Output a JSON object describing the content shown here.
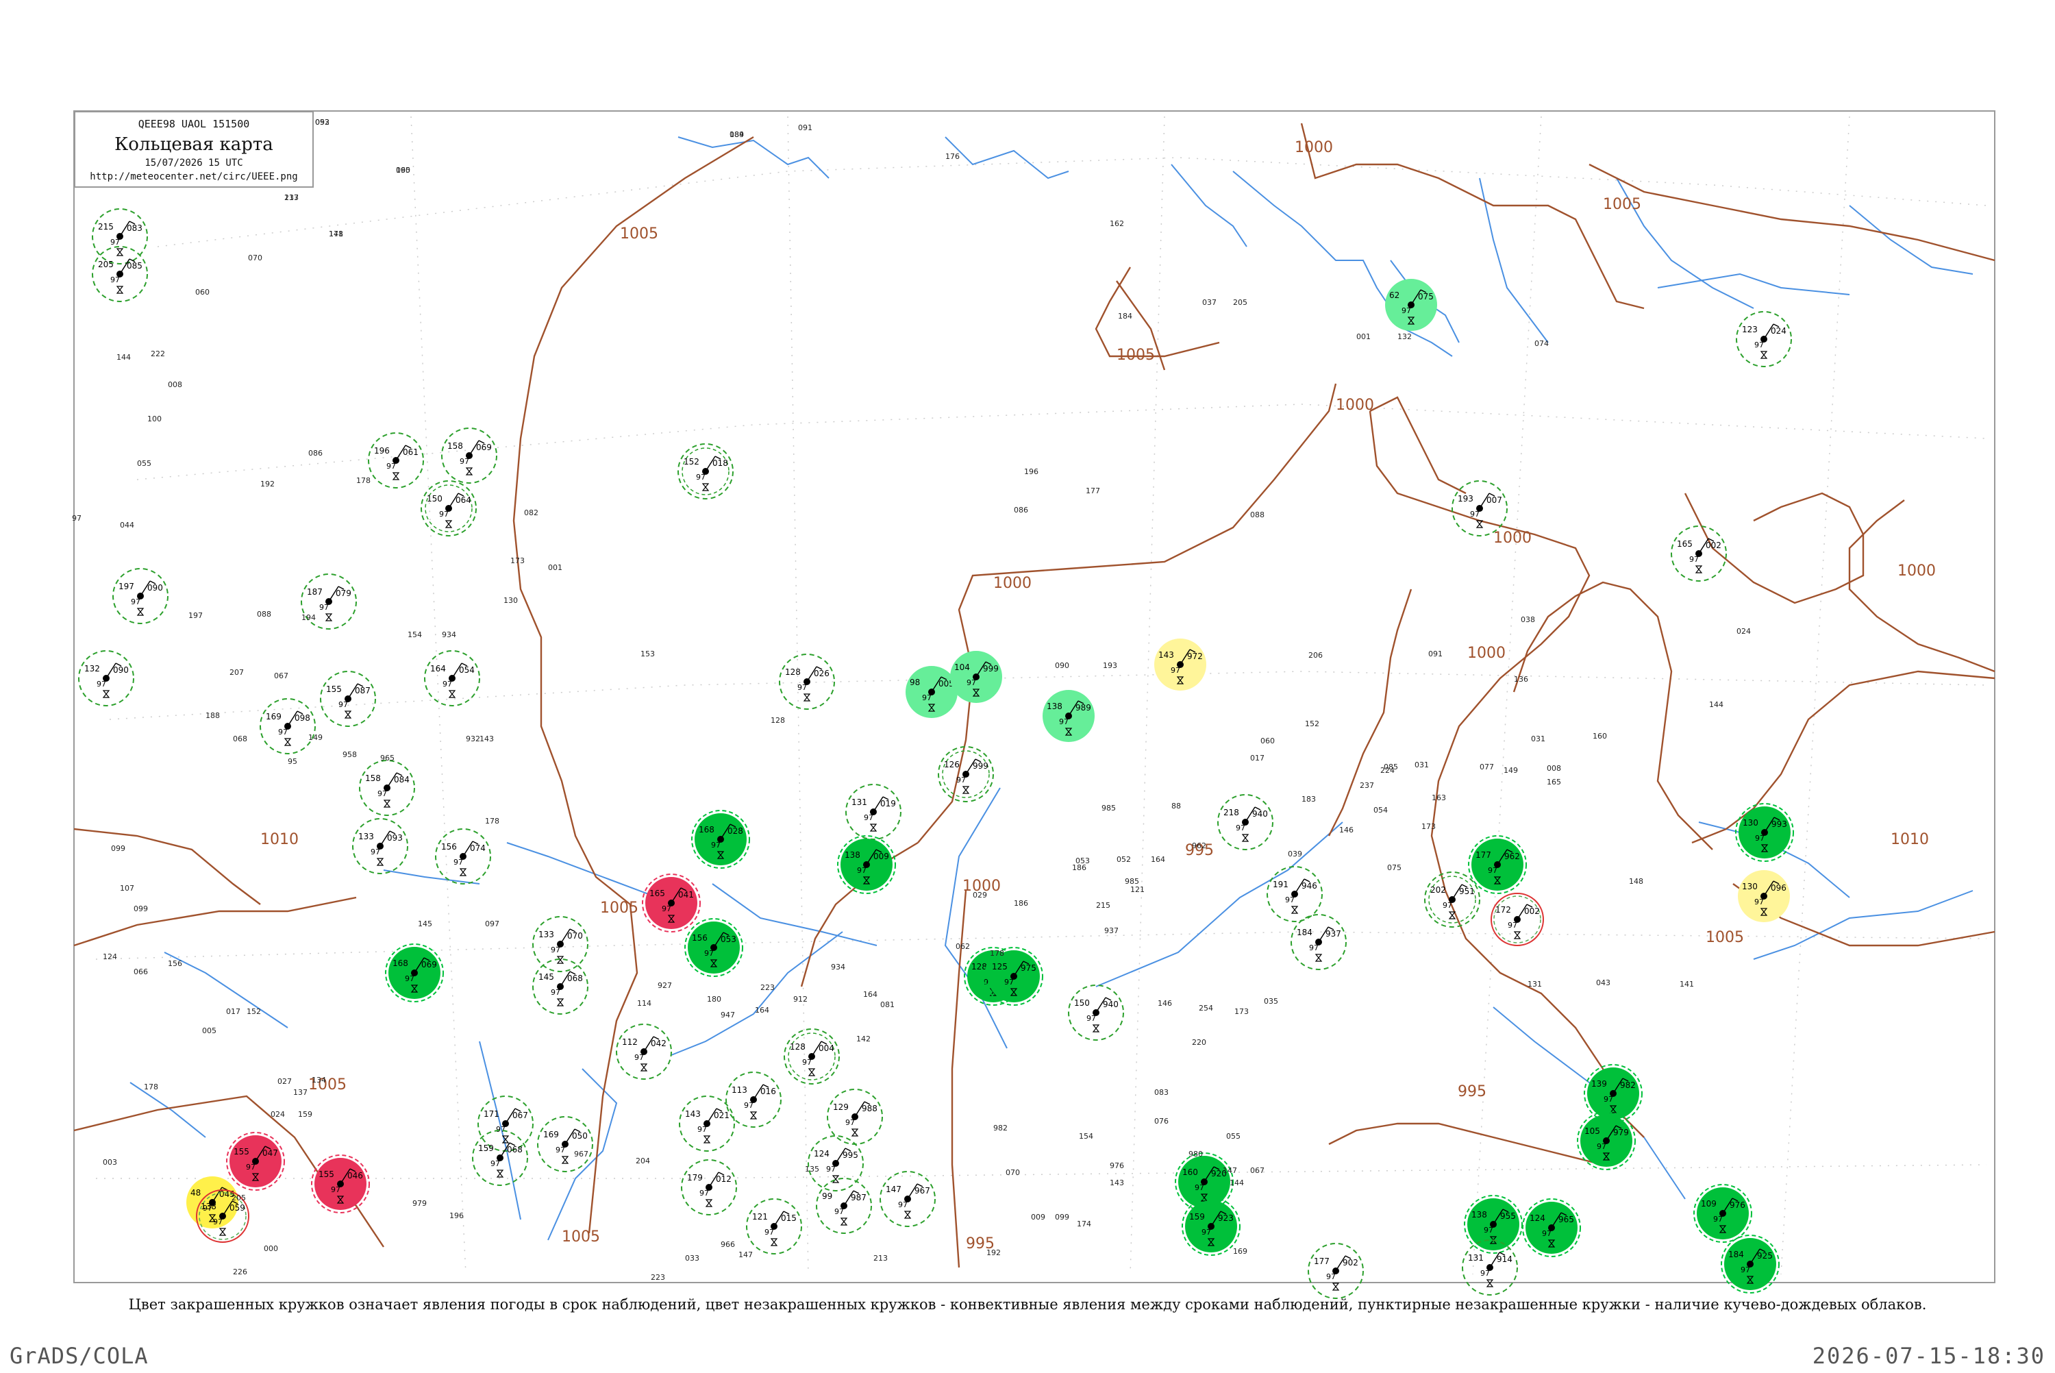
{
  "header": {
    "codes": "QEEE98  UAOL  151500",
    "title": "Кольцевая карта",
    "time": "15/07/2026 15 UTC",
    "url": "http://meteocenter.net/circ/UEEE.png"
  },
  "legend_text": "Цвет закрашенных кружков означает явления погоды в срок наблюдений, цвет незакрашенных кружков - конвективные явления между сроками наблюдений, пунктирные незакрашенные кружки - наличие кучево-дождевых облаков.",
  "footer": {
    "left": "GrADS/COLA",
    "right": "2026-07-15-18:30"
  },
  "colors": {
    "isobar": "#a0522d",
    "water": "#4a90e2",
    "dashed_circle": "#2ca02c",
    "green_fill": "#00c03a",
    "light_green_fill": "#66ee99",
    "red_fill": "#e8335a",
    "yellow_fill": "#fff04a",
    "pale_yellow_fill": "#fff59a"
  },
  "isobar_labels": [
    "1010",
    "1005",
    "1005",
    "1005",
    "1005",
    "1000",
    "1000",
    "1000",
    "1000",
    "1000",
    "995",
    "995",
    "995",
    "1005",
    "1010",
    "1005",
    "1005",
    "1000",
    "1000"
  ],
  "stations": [
    {
      "id": "s1",
      "t": "215",
      "p": "083",
      "style": "dashed",
      "fill": "none"
    },
    {
      "id": "s2",
      "t": "205",
      "p": "085",
      "style": "dashed",
      "fill": "none"
    },
    {
      "id": "s3",
      "t": "152",
      "p": "018",
      "style": "dashed2",
      "fill": "none"
    },
    {
      "id": "s4",
      "t": "150",
      "p": "064",
      "style": "dashed2",
      "fill": "none"
    },
    {
      "id": "s5",
      "t": "196",
      "p": "061",
      "style": "dashed",
      "fill": "none"
    },
    {
      "id": "s6",
      "t": "158",
      "p": "069",
      "style": "dashed",
      "fill": "none"
    },
    {
      "id": "s7",
      "t": "197",
      "p": "090",
      "style": "dashed",
      "fill": "none"
    },
    {
      "id": "s8",
      "t": "187",
      "p": "079",
      "style": "dashed",
      "fill": "none"
    },
    {
      "id": "s9",
      "t": "132",
      "p": "090",
      "style": "dashed",
      "fill": "none"
    },
    {
      "id": "s10",
      "t": "155",
      "p": "087",
      "style": "dashed",
      "fill": "none"
    },
    {
      "id": "s11",
      "t": "164",
      "p": "054",
      "style": "dashed",
      "fill": "none"
    },
    {
      "id": "s12",
      "t": "128",
      "p": "026",
      "style": "dashed",
      "fill": "none"
    },
    {
      "id": "s13",
      "t": "98",
      "p": "005",
      "style": "fill",
      "fill": "light_green"
    },
    {
      "id": "s14",
      "t": "104",
      "p": "999",
      "style": "fill",
      "fill": "light_green"
    },
    {
      "id": "s15",
      "t": "138",
      "p": "989",
      "style": "fill",
      "fill": "light_green"
    },
    {
      "id": "s16",
      "t": "143",
      "p": "972",
      "style": "fill",
      "fill": "pale_yellow"
    },
    {
      "id": "s17",
      "t": "62",
      "p": "075",
      "style": "fill",
      "fill": "light_green"
    },
    {
      "id": "s18",
      "t": "123",
      "p": "024",
      "style": "dashed",
      "fill": "none"
    },
    {
      "id": "s19",
      "t": "193",
      "p": "007",
      "style": "dashed",
      "fill": "none"
    },
    {
      "id": "s20",
      "t": "165",
      "p": "002",
      "style": "dashed",
      "fill": "none"
    },
    {
      "id": "s21",
      "t": "158",
      "p": "084",
      "style": "dashed",
      "fill": "none"
    },
    {
      "id": "s22",
      "t": "133",
      "p": "093",
      "style": "dashed",
      "fill": "none"
    },
    {
      "id": "s23",
      "t": "169",
      "p": "098",
      "style": "dashed",
      "fill": "none"
    },
    {
      "id": "s24",
      "t": "156",
      "p": "074",
      "style": "dashed",
      "fill": "none"
    },
    {
      "id": "s25",
      "t": "133",
      "p": "070",
      "style": "dashed",
      "fill": "none"
    },
    {
      "id": "s26",
      "t": "145",
      "p": "068",
      "style": "dashed",
      "fill": "none"
    },
    {
      "id": "s27",
      "t": "168",
      "p": "069",
      "style": "fill",
      "fill": "green"
    },
    {
      "id": "s28",
      "t": "165",
      "p": "041",
      "style": "fill",
      "fill": "red"
    },
    {
      "id": "s29",
      "t": "156",
      "p": "053",
      "style": "fill",
      "fill": "green"
    },
    {
      "id": "s30",
      "t": "168",
      "p": "028",
      "style": "fill",
      "fill": "green"
    },
    {
      "id": "s31",
      "t": "131",
      "p": "019",
      "style": "dashed",
      "fill": "none"
    },
    {
      "id": "s32",
      "t": "138",
      "p": "009",
      "style": "fill",
      "fill": "green"
    },
    {
      "id": "s33",
      "t": "126",
      "p": "999",
      "style": "dashed2",
      "fill": "none"
    },
    {
      "id": "s34",
      "t": "128",
      "p": "985",
      "style": "fill",
      "fill": "green"
    },
    {
      "id": "s35",
      "t": "218",
      "p": "940",
      "style": "dashed",
      "fill": "none"
    },
    {
      "id": "s36",
      "t": "191",
      "p": "946",
      "style": "dashed",
      "fill": "none"
    },
    {
      "id": "s37",
      "t": "184",
      "p": "937",
      "style": "dashed",
      "fill": "none"
    },
    {
      "id": "s38",
      "t": "202",
      "p": "951",
      "style": "dashed2",
      "fill": "none"
    },
    {
      "id": "s39",
      "t": "177",
      "p": "962",
      "style": "fill",
      "fill": "green"
    },
    {
      "id": "s40",
      "t": "172",
      "p": "002",
      "style": "solid_red",
      "fill": "none"
    },
    {
      "id": "s41",
      "t": "130",
      "p": "096",
      "style": "fill",
      "fill": "pale_yellow"
    },
    {
      "id": "s42",
      "t": "130",
      "p": "993",
      "style": "fill",
      "fill": "green"
    },
    {
      "id": "s43",
      "t": "150",
      "p": "940",
      "style": "dashed",
      "fill": "none"
    },
    {
      "id": "s44",
      "t": "112",
      "p": "042",
      "style": "dashed",
      "fill": "none"
    },
    {
      "id": "s45",
      "t": "128",
      "p": "004",
      "style": "dashed2",
      "fill": "none"
    },
    {
      "id": "s46",
      "t": "143",
      "p": "021",
      "style": "dashed",
      "fill": "none"
    },
    {
      "id": "s47",
      "t": "113",
      "p": "016",
      "style": "dashed",
      "fill": "none"
    },
    {
      "id": "s48",
      "t": "179",
      "p": "012",
      "style": "dashed",
      "fill": "none"
    },
    {
      "id": "s49",
      "t": "121",
      "p": "015",
      "style": "dashed",
      "fill": "none"
    },
    {
      "id": "s50",
      "t": "124",
      "p": "995",
      "style": "dashed",
      "fill": "none"
    },
    {
      "id": "s51",
      "t": "129",
      "p": "988",
      "style": "dashed",
      "fill": "none"
    },
    {
      "id": "s52",
      "t": "99",
      "p": "987",
      "style": "dashed",
      "fill": "none"
    },
    {
      "id": "s53",
      "t": "147",
      "p": "967",
      "style": "dashed",
      "fill": "none"
    },
    {
      "id": "s54",
      "t": "171",
      "p": "067",
      "style": "dashed",
      "fill": "none"
    },
    {
      "id": "s55",
      "t": "159",
      "p": "068",
      "style": "dashed",
      "fill": "none"
    },
    {
      "id": "s56",
      "t": "169",
      "p": "050",
      "style": "dashed",
      "fill": "none"
    },
    {
      "id": "s57",
      "t": "155",
      "p": "047",
      "style": "fill",
      "fill": "red"
    },
    {
      "id": "s58",
      "t": "155",
      "p": "046",
      "style": "fill",
      "fill": "red"
    },
    {
      "id": "s59",
      "t": "48",
      "p": "045",
      "style": "fill",
      "fill": "yellow"
    },
    {
      "id": "s60",
      "t": "138",
      "p": "059",
      "style": "solid_red",
      "fill": "none"
    },
    {
      "id": "s61",
      "t": "125",
      "p": "975",
      "style": "fill",
      "fill": "green"
    },
    {
      "id": "s62",
      "t": "160",
      "p": "920",
      "style": "fill",
      "fill": "green"
    },
    {
      "id": "s63",
      "t": "159",
      "p": "923",
      "style": "fill",
      "fill": "green"
    },
    {
      "id": "s64",
      "t": "138",
      "p": "955",
      "style": "fill",
      "fill": "green"
    },
    {
      "id": "s65",
      "t": "124",
      "p": "965",
      "style": "fill",
      "fill": "green"
    },
    {
      "id": "s66",
      "t": "139",
      "p": "982",
      "style": "fill",
      "fill": "green"
    },
    {
      "id": "s67",
      "t": "105",
      "p": "979",
      "style": "fill",
      "fill": "green"
    },
    {
      "id": "s68",
      "t": "109",
      "p": "976",
      "style": "fill",
      "fill": "green"
    },
    {
      "id": "s69",
      "t": "177",
      "p": "902",
      "style": "dashed",
      "fill": "none"
    },
    {
      "id": "s70",
      "t": "131",
      "p": "914",
      "style": "dashed",
      "fill": "none"
    },
    {
      "id": "s71",
      "t": "184",
      "p": "925",
      "style": "fill",
      "fill": "green"
    }
  ],
  "plain_numbers": [
    "093",
    "217",
    "171",
    "095",
    "189",
    "091",
    "176",
    "070",
    "162",
    "184",
    "037",
    "205",
    "001",
    "132",
    "074",
    "144",
    "060",
    "222",
    "008",
    "100",
    "055",
    "97",
    "044",
    "192",
    "086",
    "178",
    "082",
    "196",
    "086",
    "177",
    "088",
    "194",
    "090",
    "193",
    "206",
    "091",
    "197",
    "088",
    "207",
    "067",
    "188",
    "068",
    "153",
    "038",
    "136",
    "031",
    "160",
    "024",
    "144",
    "008",
    "165",
    "149",
    "077",
    "163",
    "085",
    "173",
    "075",
    "131",
    "985",
    "186",
    "985",
    "178",
    "097",
    "145",
    "099",
    "107",
    "099",
    "124",
    "066",
    "156",
    "017",
    "152",
    "005",
    "134",
    "027",
    "137",
    "178",
    "024",
    "159",
    "003",
    "226",
    "000",
    "205",
    "979",
    "196",
    "967",
    "204",
    "223",
    "966",
    "147",
    "947",
    "164",
    "982",
    "154",
    "976",
    "143",
    "980",
    "144",
    "067",
    "147",
    "083",
    "076",
    "220",
    "254",
    "035",
    "173",
    "055",
    "192",
    "070",
    "169",
    "009",
    "174",
    "099",
    "164",
    "081",
    "128",
    "135",
    "213",
    "033",
    "223",
    "029",
    "186",
    "062",
    "178",
    "052",
    "164",
    "053",
    "215",
    "017",
    "183",
    "054",
    "146",
    "060",
    "148",
    "043",
    "141",
    "039",
    "152",
    "031",
    "224",
    "237",
    "88",
    "962",
    "121",
    "937",
    "146",
    "927",
    "114",
    "180",
    "912",
    "142",
    "934",
    "143",
    "932",
    "154",
    "934",
    "149",
    "958",
    "95",
    "965",
    "173",
    "001",
    "130",
    "052",
    "133",
    "148",
    "160",
    "084"
  ]
}
